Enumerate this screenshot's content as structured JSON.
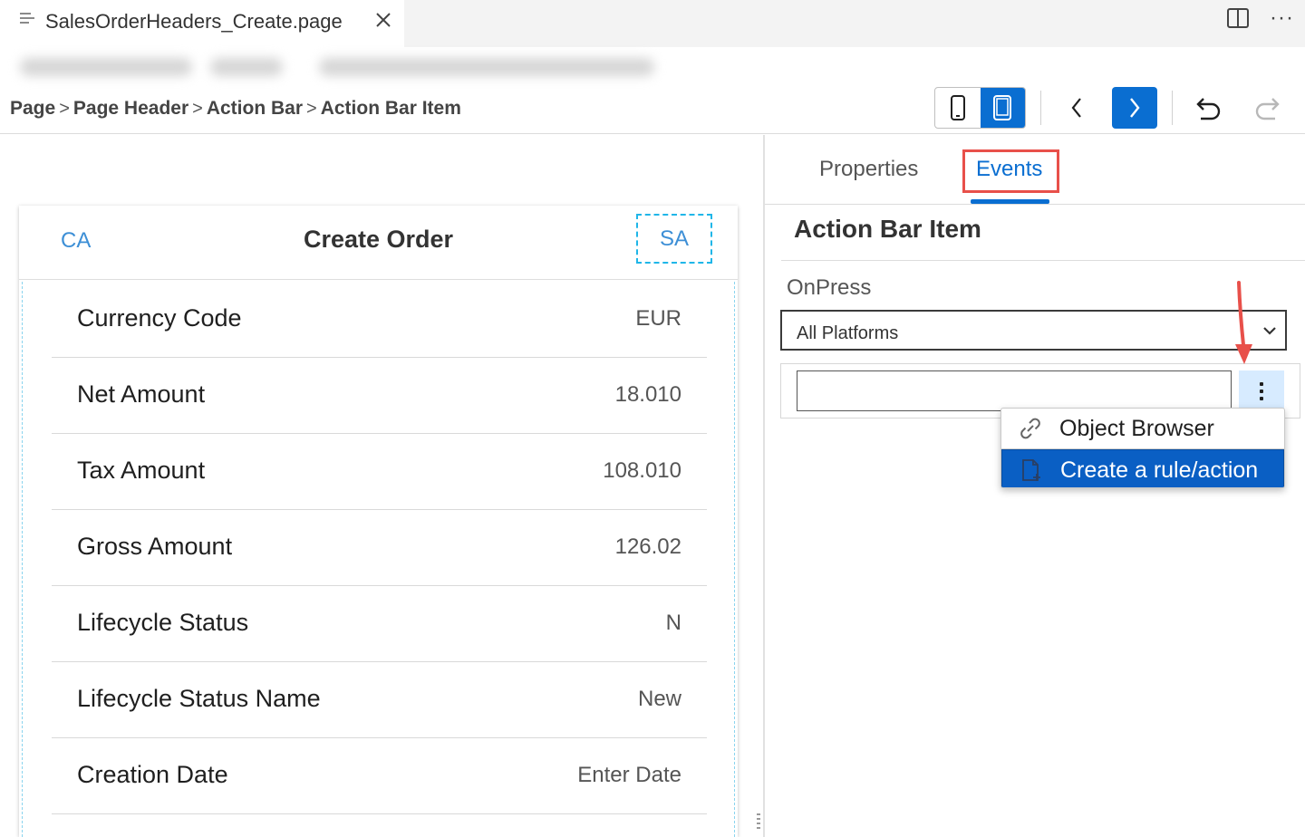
{
  "editor_tab": {
    "file_name": "SalesOrderHeaders_Create.page",
    "icons": {
      "file": "file-lines-icon",
      "close": "close-icon",
      "split": "split-editor-icon",
      "more": "more-actions-icon"
    },
    "more_label": "···"
  },
  "breadcrumb": {
    "items": [
      "Page",
      "Page Header",
      "Action Bar",
      "Action Bar Item"
    ],
    "separator": ">"
  },
  "toolbar": {
    "device_buttons": [
      {
        "icon": "phone-icon",
        "active": false
      },
      {
        "icon": "tablet-icon",
        "active": true
      }
    ],
    "nav": [
      {
        "icon": "chevron-left-icon"
      },
      {
        "icon": "chevron-right-icon",
        "active": true
      }
    ],
    "history": [
      {
        "icon": "undo-icon",
        "enabled": true
      },
      {
        "icon": "redo-icon",
        "enabled": false
      }
    ],
    "accent_color": "#0a6ed1"
  },
  "preview": {
    "header": {
      "left_action": "CA",
      "title": "Create Order",
      "right_action": "SA"
    },
    "rows": [
      {
        "label": "Currency Code",
        "value": "EUR"
      },
      {
        "label": "Net Amount",
        "value": "18.010"
      },
      {
        "label": "Tax Amount",
        "value": "108.010"
      },
      {
        "label": "Gross Amount",
        "value": "126.02"
      },
      {
        "label": "Lifecycle Status",
        "value": "N"
      },
      {
        "label": "Lifecycle Status Name",
        "value": "New"
      },
      {
        "label": "Creation Date",
        "value": "Enter Date"
      }
    ]
  },
  "properties_panel": {
    "tabs": [
      {
        "label": "Properties",
        "active": false
      },
      {
        "label": "Events",
        "active": true
      }
    ],
    "section_title": "Action Bar Item",
    "event_name": "OnPress",
    "platform_select": {
      "selected": "All Platforms"
    },
    "value_input": {
      "value": ""
    },
    "menu": {
      "items": [
        {
          "label": "Object Browser",
          "icon": "link-icon",
          "selected": false
        },
        {
          "label": "Create a rule/action",
          "icon": "new-file-icon",
          "selected": true
        }
      ]
    },
    "highlight_color": "#e8504a"
  }
}
